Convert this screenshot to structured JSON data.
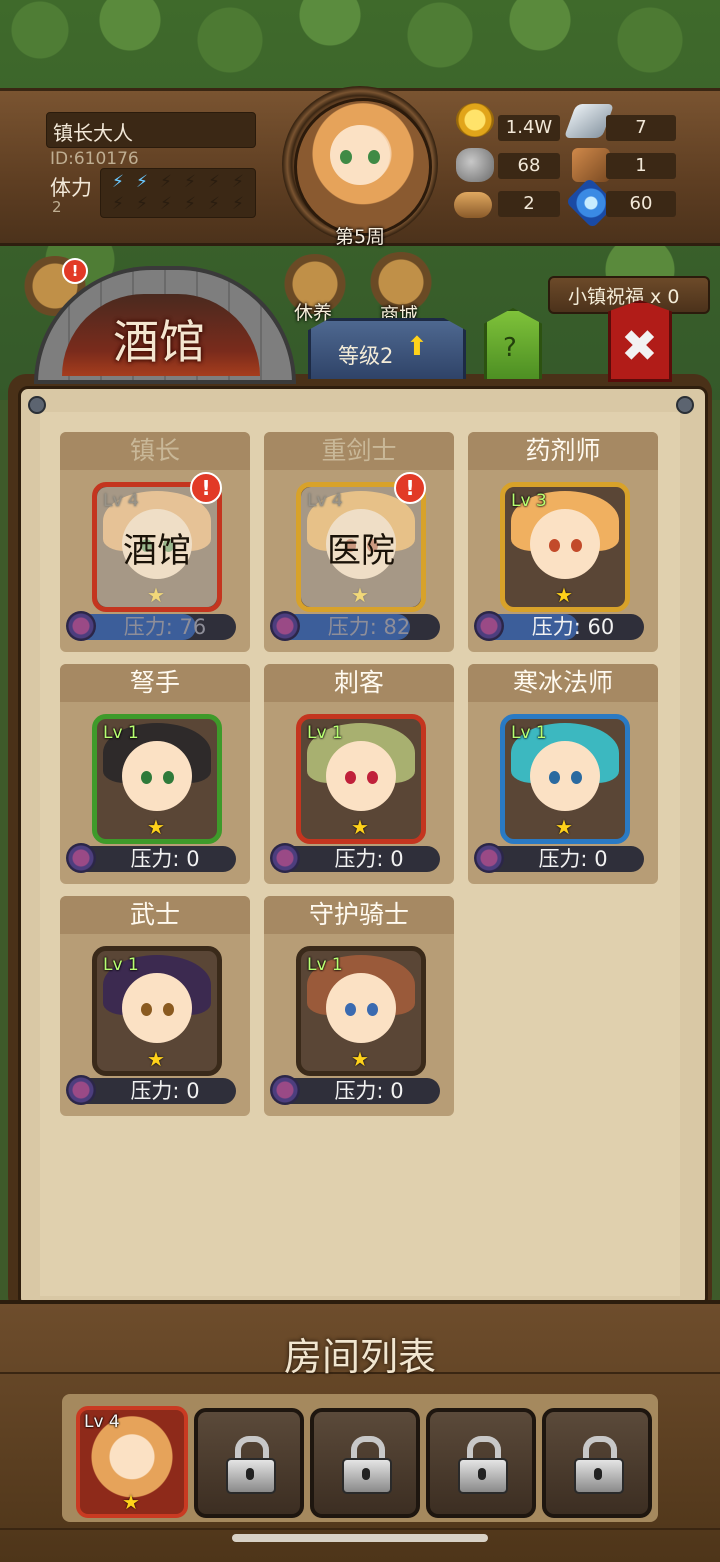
{
  "header": {
    "player_name": "镇长大人",
    "player_id": "ID:610176",
    "stamina_label": "体力",
    "stamina_value": "2",
    "stamina_filled": 2,
    "stamina_total": 12,
    "week": "第5周"
  },
  "resources": [
    {
      "icon": "gold-coin-icon",
      "value": "1.4W"
    },
    {
      "icon": "iron-ingot-icon",
      "value": "7"
    },
    {
      "icon": "stone-icon",
      "value": "68"
    },
    {
      "icon": "leather-icon",
      "value": "1"
    },
    {
      "icon": "wood-log-icon",
      "value": "2"
    },
    {
      "icon": "crystal-icon",
      "value": "60"
    }
  ],
  "menu": {
    "rest_label": "休养",
    "shop_label": "商城",
    "blessing_label": "小镇祝福 x 0"
  },
  "tabs": {
    "tavern_title": "酒馆",
    "level_label": "等级2",
    "help_label": "?",
    "close_label": "✖"
  },
  "heroes": [
    {
      "class": "镇长",
      "level": "Lv 4",
      "stress": "压力: 76",
      "building": "酒馆",
      "alert": "!",
      "frame": "#c4351f",
      "hair": "#e6a35a",
      "eye": "#3f8a45"
    },
    {
      "class": "重剑士",
      "level": "Lv 4",
      "stress": "压力: 82",
      "building": "医院",
      "alert": "!",
      "frame": "#d8a22a",
      "hair": "#e8a13a",
      "eye": "#b04a2a"
    },
    {
      "class": "药剂师",
      "level": "Lv 3",
      "stress": "压力: 60",
      "building": "",
      "alert": "",
      "frame": "#d8a22a",
      "hair": "#f0b060",
      "eye": "#c24a2a"
    },
    {
      "class": "弩手",
      "level": "Lv 1",
      "stress": "压力: 0",
      "building": "",
      "alert": "",
      "frame": "#3e9a2a",
      "hair": "#2e2a2a",
      "eye": "#2f7a3a"
    },
    {
      "class": "刺客",
      "level": "Lv 1",
      "stress": "压力: 0",
      "building": "",
      "alert": "",
      "frame": "#c4351f",
      "hair": "#a8b070",
      "eye": "#c0203a"
    },
    {
      "class": "寒冰法师",
      "level": "Lv 1",
      "stress": "压力: 0",
      "building": "",
      "alert": "",
      "frame": "#2a7ac4",
      "hair": "#3cb8c0",
      "eye": "#2a6aa0"
    },
    {
      "class": "武士",
      "level": "Lv 1",
      "stress": "压力: 0",
      "building": "",
      "alert": "",
      "frame": "#3a2a1a",
      "hair": "#3c2a50",
      "eye": "#8a5a20"
    },
    {
      "class": "守护骑士",
      "level": "Lv 1",
      "stress": "压力: 0",
      "building": "",
      "alert": "",
      "frame": "#3a2a1a",
      "hair": "#9a5a3a",
      "eye": "#3a6ab0"
    }
  ],
  "stress_fill": [
    0.76,
    0.82,
    0.6,
    0,
    0,
    0,
    0,
    0
  ],
  "room_list": {
    "title": "房间列表",
    "first_room_level": "Lv 4",
    "locked_count": 4
  }
}
